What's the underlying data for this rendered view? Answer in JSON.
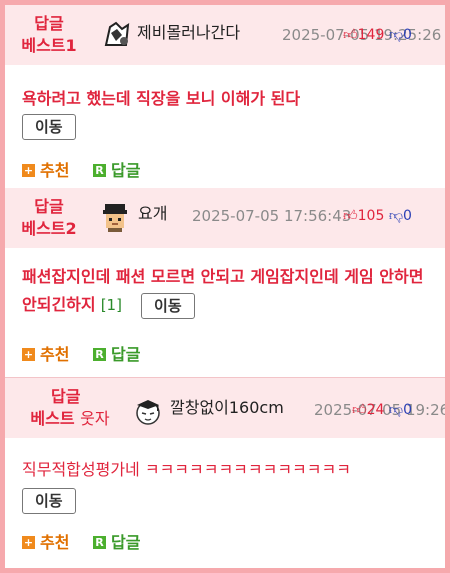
{
  "replies": [
    {
      "best_label_line1": "답글",
      "best_label_line2": "베스트1",
      "best_label_extra": "",
      "nickname": "제비몰러나간다",
      "date": "2025-07-05 19:25:26",
      "up": "149",
      "down": "0",
      "content": "욕하려고 했는데 직장을 보니 이해가 된다",
      "comment_count": "",
      "move_label": "이동",
      "recommend_label": "추천",
      "reply_label": "답글"
    },
    {
      "best_label_line1": "답글",
      "best_label_line2": "베스트2",
      "best_label_extra": "",
      "nickname": "요개",
      "date": "2025-07-05 17:56:43",
      "up": "105",
      "down": "0",
      "content": "패션잡지인데 패션 모르면 안되고 게임잡지인데 게임 안하면 안되긴하지",
      "comment_count": "[1]",
      "move_label": "이동",
      "recommend_label": "추천",
      "reply_label": "답글"
    },
    {
      "best_label_line1": "답글",
      "best_label_line2": "베스트",
      "best_label_extra": "웃자",
      "nickname": "깔창없이160cm",
      "date": "2025-07-05 19:26",
      "up": "24",
      "down": "0",
      "content": "직무적합성평가네 ㅋㅋㅋㅋㅋㅋㅋㅋㅋㅋㅋㅋㅋㅋ",
      "comment_count": "",
      "move_label": "이동",
      "recommend_label": "추천",
      "reply_label": "답글"
    }
  ],
  "icons": {
    "thumbs_up": "thumbs-up-icon",
    "thumbs_down": "thumbs-down-icon",
    "recommend": "plus-icon",
    "reply": "reply-r-icon"
  },
  "colors": {
    "frame_border": "#f6a9ad",
    "header_bg": "#fde8ea",
    "accent_red": "#e0253d",
    "down_blue": "#2a3fb5",
    "recommend_orange": "#e07000",
    "reply_green": "#3a9a2a"
  }
}
